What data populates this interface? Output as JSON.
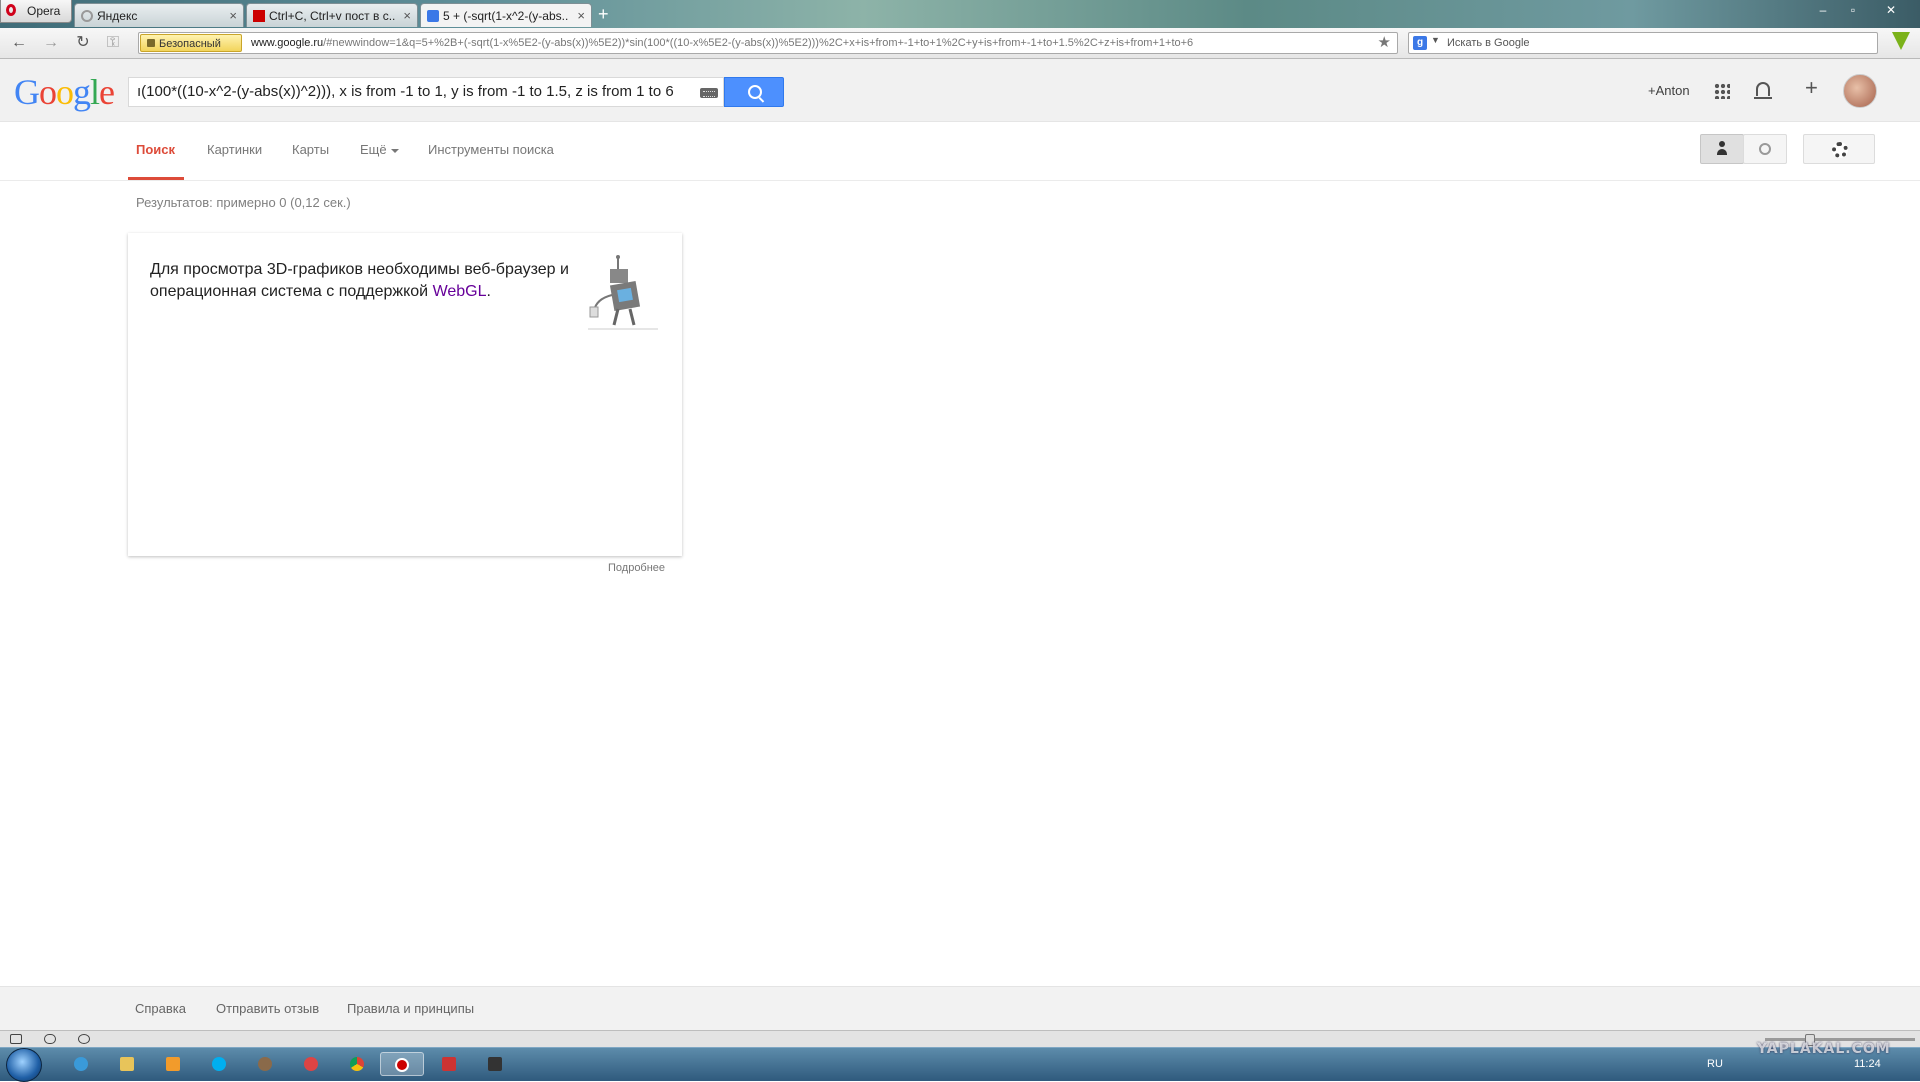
{
  "browser": {
    "menu_label": "Opera",
    "tabs": [
      {
        "label": "Яндекс",
        "close": "×"
      },
      {
        "label": "Ctrl+C, Ctrl+v пост в с...",
        "close": "×"
      },
      {
        "label": "5 + (-sqrt(1-x^2-(y-abs...",
        "close": "×"
      }
    ],
    "new_tab": "+",
    "security_label": "Безопасный",
    "url_domain": "www.google.ru",
    "url_rest": "/#newwindow=1&q=5+%2B+(-sqrt(1-x%5E2-(y-abs(x))%5E2))*sin(100*((10-x%5E2-(y-abs(x))%5E2)))%2C+x+is+from+-1+to+1%2C+y+is+from+-1+to+1.5%2C+z+is+from+1+to+6",
    "search_placeholder": "Искать в Google",
    "window_controls": [
      "–",
      "▫",
      "✕"
    ]
  },
  "google": {
    "logo_letters": [
      "G",
      "o",
      "o",
      "g",
      "l",
      "e"
    ],
    "query": "ı(100*((10-x^2-(y-abs(x))^2))), x is from -1 to 1, y is from -1 to 1.5, z is from 1 to 6",
    "user_name": "+Anton",
    "tabs": [
      "Поиск",
      "Картинки",
      "Карты",
      "Ещё",
      "Инструменты поиска"
    ],
    "result_stats": "Результатов: примерно 0 (0,12 сек.)",
    "card_text": "Для просмотра 3D-графиков необходимы веб-браузер и операционная система с поддержкой ",
    "card_link": "WebGL",
    "card_text_end": ".",
    "more_link": "Подробнее",
    "footer_links": [
      "Справка",
      "Отправить отзыв",
      "Правила и принципы"
    ]
  },
  "system": {
    "language": "RU",
    "time": "11:24",
    "watermark": "YAPLAKAL.COM"
  },
  "colors": {
    "google_blue": "#4d90fe",
    "active_tab_red": "#dd4b39",
    "visited_link": "#660099"
  }
}
